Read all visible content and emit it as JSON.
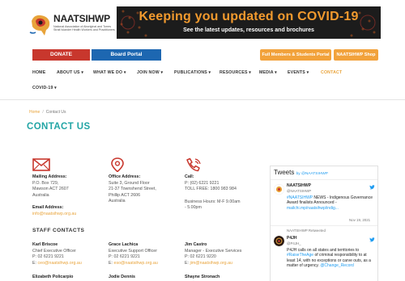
{
  "site": {
    "logo_title": "NAATSIHWP",
    "logo_subtitle": "National Association of Aboriginal and Torres Strait Islander Health Workers and Practitioners"
  },
  "banner": {
    "title": "Keeping you updated on COVID-19",
    "subtitle": "See the latest updates, resources and brochures"
  },
  "buttons": {
    "donate": "DONATE",
    "board_portal": "Board Portal",
    "members_portal": "Full Members & Students Portal",
    "shop": "NAATSIHWP Shop"
  },
  "nav": {
    "items": [
      {
        "label": "HOME"
      },
      {
        "label": "ABOUT US ▾"
      },
      {
        "label": "WHAT WE DO ▾"
      },
      {
        "label": "JOIN NOW ▾"
      },
      {
        "label": "PUBLICATIONS ▾"
      },
      {
        "label": "RESOURCES ▾"
      },
      {
        "label": "MEDIA ▾"
      },
      {
        "label": "EVENTS ▾"
      },
      {
        "label": "CONTACT"
      },
      {
        "label": "COVID-19 ▾"
      }
    ]
  },
  "breadcrumb": {
    "home": "Home",
    "separator": "/",
    "current": "Contact Us"
  },
  "page_title": "CONTACT US",
  "contact": {
    "mailing": {
      "label": "Mailing Address:",
      "line1": "P.O. Box 729,",
      "line2": "Mawson ACT 2607",
      "line3": "Australia",
      "email_label": "Email Address:",
      "email": "info@naatsihwp.org.au"
    },
    "office": {
      "label": "Office Address:",
      "line1": "Suite 3, Ground Floor",
      "line2": "21-37 Townshend Street,",
      "line3": "Phillip ACT 2606",
      "line4": "Australia"
    },
    "call": {
      "label": "Call:",
      "phone": "P: (02) 6221 9221",
      "tollfree": "TOLL FREE: 1800 983 984",
      "hours_line1": "Business Hours: M-F 9.00am",
      "hours_line2": "- 5.00pm"
    }
  },
  "staff_heading": "STAFF CONTACTS",
  "staff": [
    {
      "name": "Karl Briscoe",
      "role": "Chief Executive Officer",
      "phone": "P: 02 6221 9221",
      "email_prefix": "E:",
      "email": "ceo@naatsihwp.org.au"
    },
    {
      "name": "Grace Lachica",
      "role": "Executive Support Officer",
      "phone": "P: 02 6221 9221",
      "email_prefix": "E:",
      "email": "eso@naatsihwp.org.au"
    },
    {
      "name": "Jim Castro",
      "role": "Manager - Executive Services",
      "phone": "P: 02 6221 9220",
      "email_prefix": "E:",
      "email": "jim@naatsihwp.org.au"
    }
  ],
  "staff_next": [
    "Elizabeth Policarpio",
    "Jodie Dennis",
    "Shayne Stronach"
  ],
  "twitter": {
    "title": "Tweets",
    "by": "by @NAATSIHWP",
    "tweet1": {
      "name": "NAATSIHWP",
      "handle": "@NAATSIHWP",
      "text_hash": "#NAATSIHWP",
      "text_body": " NEWS - Indigenous Governance Award finalists Announced -",
      "text_link": "mailchi.mp/naatsihwp/indig...",
      "date": "Nov 19, 2021"
    },
    "retweet_label": "NAATSIHWP Retweeted",
    "tweet2": {
      "name": "P4JH",
      "handle": "@P4JH_",
      "text_a": "P4JH calls on all states and territories to ",
      "text_hash": "#RaiseTheAge",
      "text_b": " of criminal responsibility to at least 14, with no exceptions or carve outs, as a matter of urgency.",
      "text_link": "@Change_Record"
    }
  },
  "colors": {
    "accent_teal": "#22a5a5",
    "accent_orange": "#e8a33a",
    "donate_red": "#c8372d",
    "board_blue": "#1d67b1",
    "banner_orange": "#f29a2e",
    "twitter_blue": "#1d9bf0"
  }
}
